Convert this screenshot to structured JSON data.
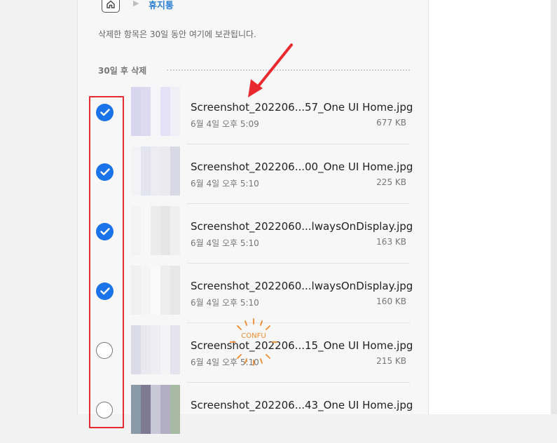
{
  "breadcrumb": {
    "current": "휴지통"
  },
  "info_text": "삭제한 항목은 30일 동안 여기에 보관됩니다.",
  "section_title": "30일 후 삭제",
  "files": [
    {
      "name": "Screenshot_202206...57_One UI Home.jpg",
      "date": "6월 4일 오후 5:09",
      "size": "677 KB",
      "checked": true
    },
    {
      "name": "Screenshot_202206...00_One UI Home.jpg",
      "date": "6월 4일 오후 5:10",
      "size": "225 KB",
      "checked": true
    },
    {
      "name": "Screenshot_2022060...lwaysOnDisplay.jpg",
      "date": "6월 4일 오후 5:10",
      "size": "163 KB",
      "checked": true
    },
    {
      "name": "Screenshot_2022060...lwaysOnDisplay.jpg",
      "date": "6월 4일 오후 5:10",
      "size": "160 KB",
      "checked": true
    },
    {
      "name": "Screenshot_202206...15_One UI Home.jpg",
      "date": "6월 4일 오후 5:10",
      "size": "215 KB",
      "checked": false
    },
    {
      "name": "Screenshot_202206...43_One UI Home.jpg",
      "date": "",
      "size": "",
      "checked": false
    }
  ],
  "watermark_text": "CONFU",
  "colors": {
    "accent": "#1a73e8",
    "annotation": "#e8292f",
    "link": "#2a7fd4"
  },
  "icons": {
    "home": "home-icon",
    "breadcrumb_separator": "play-arrow-icon",
    "check": "checkmark-icon"
  }
}
